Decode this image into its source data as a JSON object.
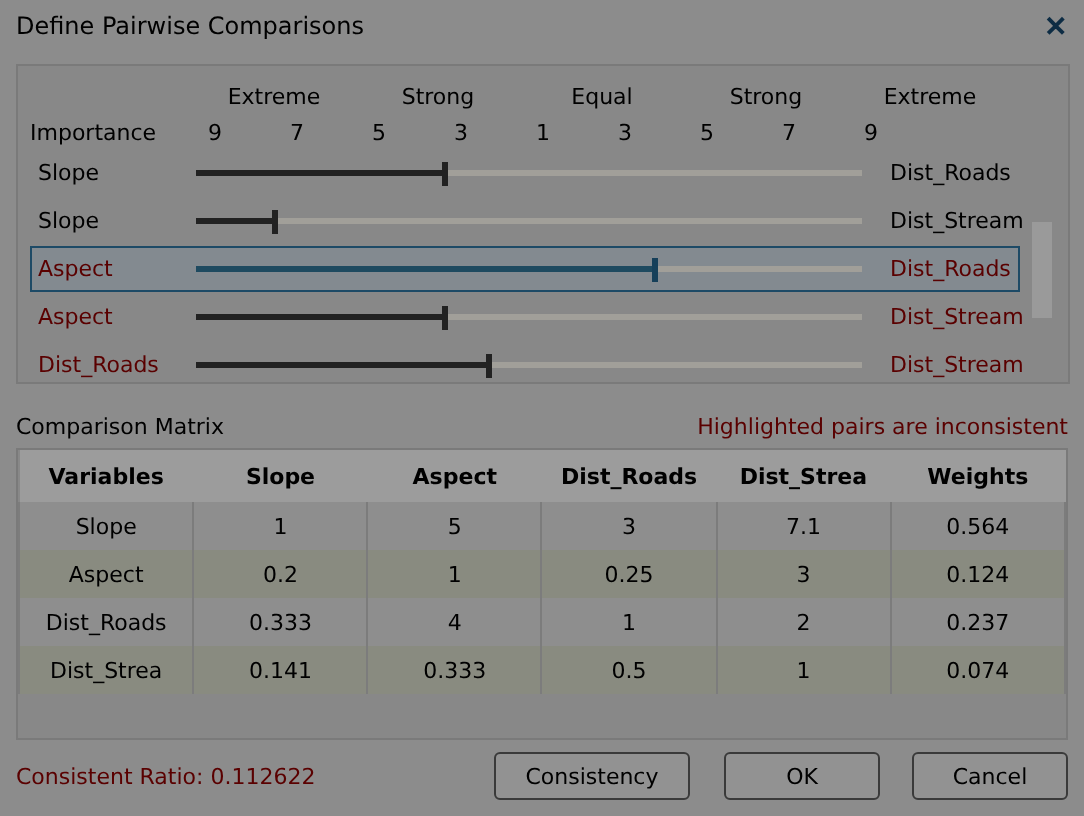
{
  "window": {
    "title": "Define Pairwise Comparisons",
    "close": "✕"
  },
  "scale": {
    "strengths": [
      "Extreme",
      "Strong",
      "Equal",
      "Strong",
      "Extreme"
    ],
    "importance_label": "Importance",
    "ticks": [
      "9",
      "7",
      "5",
      "3",
      "1",
      "3",
      "5",
      "7",
      "9"
    ]
  },
  "comparisons": [
    {
      "left": "Slope",
      "right": "Dist_Roads",
      "level": 0.375,
      "inconsistent": false,
      "selected": false
    },
    {
      "left": "Slope",
      "right": "Dist_Stream",
      "level": 0.12,
      "inconsistent": false,
      "selected": false
    },
    {
      "left": "Aspect",
      "right": "Dist_Roads",
      "level": 0.69,
      "inconsistent": true,
      "selected": true
    },
    {
      "left": "Aspect",
      "right": "Dist_Stream",
      "level": 0.375,
      "inconsistent": true,
      "selected": false
    },
    {
      "left": "Dist_Roads",
      "right": "Dist_Stream",
      "level": 0.44,
      "inconsistent": true,
      "selected": false
    }
  ],
  "matrix": {
    "title": "Comparison Matrix",
    "note": "Highlighted pairs are inconsistent",
    "columns": [
      "Variables",
      "Slope",
      "Aspect",
      "Dist_Roads",
      "Dist_Strea",
      "Weights"
    ],
    "rows": [
      [
        "Slope",
        "1",
        "5",
        "3",
        "7.1",
        "0.564"
      ],
      [
        "Aspect",
        "0.2",
        "1",
        "0.25",
        "3",
        "0.124"
      ],
      [
        "Dist_Roads",
        "0.333",
        "4",
        "1",
        "2",
        "0.237"
      ],
      [
        "Dist_Strea",
        "0.141",
        "0.333",
        "0.5",
        "1",
        "0.074"
      ]
    ]
  },
  "ratio": "Consistent Ratio: 0.112622",
  "buttons": [
    "Consistency",
    "OK",
    "Cancel"
  ]
}
